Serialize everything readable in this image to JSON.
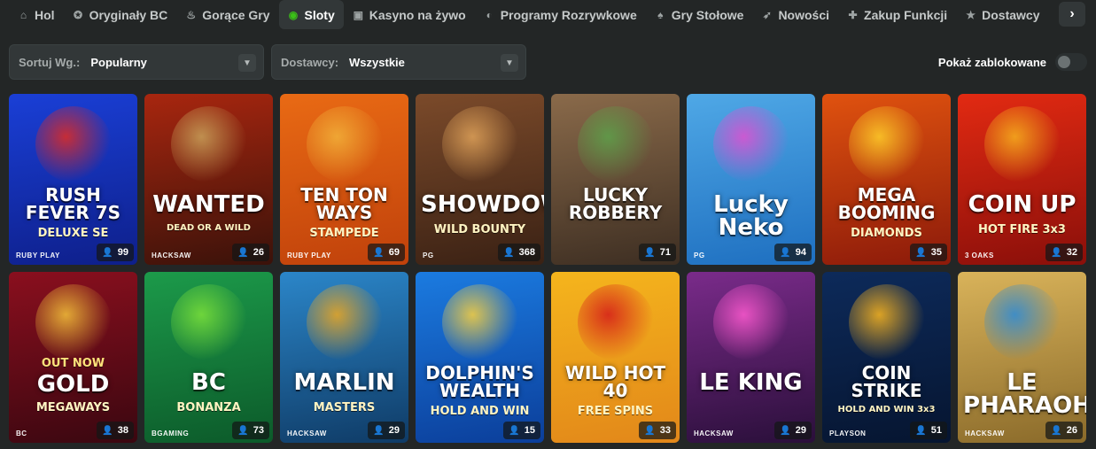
{
  "nav": {
    "items": [
      {
        "label": "Hol",
        "icon": "home-icon",
        "glyph": "⌂"
      },
      {
        "label": "Oryginały BC",
        "icon": "bc-originals-icon",
        "glyph": "✪"
      },
      {
        "label": "Gorące Gry",
        "icon": "flame-icon",
        "glyph": "♨"
      },
      {
        "label": "Sloty",
        "icon": "slots-icon",
        "glyph": "◉",
        "active": true
      },
      {
        "label": "Kasyno na żywo",
        "icon": "live-casino-icon",
        "glyph": "▣"
      },
      {
        "label": "Programy Rozrywkowe",
        "icon": "game-shows-icon",
        "glyph": "◐"
      },
      {
        "label": "Gry Stołowe",
        "icon": "table-games-icon",
        "glyph": "♠"
      },
      {
        "label": "Nowości",
        "icon": "rocket-icon",
        "glyph": "➶"
      },
      {
        "label": "Zakup Funkcji",
        "icon": "feature-buy-icon",
        "glyph": "✚"
      },
      {
        "label": "Dostawcy",
        "icon": "star-icon",
        "glyph": "★"
      }
    ],
    "next_glyph": "›"
  },
  "filters": {
    "sort_label": "Sortuj Wg.:",
    "sort_value": "Popularny",
    "provider_label": "Dostawcy:",
    "provider_value": "Wszystkie",
    "show_blocked_label": "Pokaż zablokowane",
    "show_blocked_on": false
  },
  "games": [
    {
      "title": "RUSH FEVER 7S",
      "subtitle": "DELUXE SE",
      "provider": "RUBY PLAY",
      "players": "99",
      "bg": [
        "#1a3fd6",
        "#0e1f8a"
      ],
      "accent": "#e42b1f"
    },
    {
      "title": "WANTED",
      "subtitle": "DEAD OR A WILD",
      "provider": "HACKSAW",
      "players": "26",
      "bg": [
        "#a8260f",
        "#3a120a"
      ],
      "accent": "#c9a25a"
    },
    {
      "title": "TEN TON WAYS",
      "subtitle": "STAMPEDE",
      "provider": "RUBY PLAY",
      "players": "69",
      "bg": [
        "#e96a14",
        "#c0410b"
      ],
      "accent": "#f2b23a"
    },
    {
      "title": "SHOWDOWN",
      "subtitle": "WILD BOUNTY",
      "provider": "PG",
      "players": "368",
      "bg": [
        "#7b4a2a",
        "#3a2114"
      ],
      "accent": "#e0a35a"
    },
    {
      "title": "LUCKY ROBBERY",
      "subtitle": "",
      "provider": "",
      "players": "71",
      "bg": [
        "#8a6a4a",
        "#3d2e22"
      ],
      "accent": "#5da14a"
    },
    {
      "title": "Lucky Neko",
      "subtitle": "",
      "provider": "PG",
      "players": "94",
      "bg": [
        "#4fa8e6",
        "#1e6fc0"
      ],
      "accent": "#e24fd0"
    },
    {
      "title": "MEGA BOOMING",
      "subtitle": "DIAMONDS",
      "provider": "",
      "players": "35",
      "bg": [
        "#e0520f",
        "#8c1a0a"
      ],
      "accent": "#ffd02a"
    },
    {
      "title": "COIN UP",
      "subtitle": "HOT FIRE 3x3",
      "provider": "3 OAKS",
      "players": "32",
      "bg": [
        "#e22a12",
        "#8a0f0a"
      ],
      "accent": "#f7b21e"
    },
    {
      "title": "GOLD",
      "subtitle": "MEGAWAYS",
      "provider": "BC",
      "players": "38",
      "bg": [
        "#8a0f1e",
        "#3a0710"
      ],
      "accent": "#f5c33a",
      "tagline": "OUT NOW"
    },
    {
      "title": "BC",
      "subtitle": "BONANZA",
      "provider": "BGAMING",
      "players": "73",
      "bg": [
        "#1c9a4a",
        "#0c5a2a"
      ],
      "accent": "#7de23a"
    },
    {
      "title": "MARLIN",
      "subtitle": "MASTERS",
      "provider": "HACKSAW",
      "players": "29",
      "bg": [
        "#2b86c9",
        "#0f3b66"
      ],
      "accent": "#f0a81e"
    },
    {
      "title": "DOLPHIN'S WEALTH",
      "subtitle": "HOLD AND WIN",
      "provider": "",
      "players": "15",
      "bg": [
        "#1b7be0",
        "#0b3e9a"
      ],
      "accent": "#ffd23a"
    },
    {
      "title": "WILD HOT 40",
      "subtitle": "FREE SPINS",
      "provider": "",
      "players": "33",
      "bg": [
        "#f5b51c",
        "#e2871a"
      ],
      "accent": "#d41a1a"
    },
    {
      "title": "LE KING",
      "subtitle": "",
      "provider": "HACKSAW",
      "players": "29",
      "bg": [
        "#7a2b8a",
        "#2a0f3a"
      ],
      "accent": "#ff5ad0"
    },
    {
      "title": "COIN STRIKE",
      "subtitle": "HOLD AND WIN 3x3",
      "provider": "PLAYSON",
      "players": "51",
      "bg": [
        "#0d2a5a",
        "#061530"
      ],
      "accent": "#ffb81e"
    },
    {
      "title": "LE PHARAOH",
      "subtitle": "",
      "provider": "HACKSAW",
      "players": "26",
      "bg": [
        "#d9b35a",
        "#8a6a2a"
      ],
      "accent": "#2a8ad9"
    }
  ]
}
